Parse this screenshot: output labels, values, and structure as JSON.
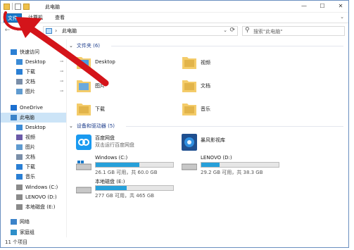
{
  "window": {
    "title": "此电脑",
    "minimize": "—",
    "maximize": "☐",
    "close": "✕"
  },
  "ribbon": {
    "tabs": [
      "文件",
      "计算机",
      "查看"
    ],
    "expand": "⌄"
  },
  "address": {
    "back": "←",
    "forward": "→",
    "up": "↑",
    "separator": "›",
    "path": "此电脑",
    "refresh": "⟳",
    "search_placeholder": "搜索\"此电脑\""
  },
  "sidebar": {
    "items": [
      {
        "label": "快速访问",
        "icon": "star-icon",
        "pinned": false
      },
      {
        "label": "Desktop",
        "icon": "desktop-folder-icon",
        "pinned": true
      },
      {
        "label": "下载",
        "icon": "download-folder-icon",
        "pinned": true
      },
      {
        "label": "文档",
        "icon": "documents-folder-icon",
        "pinned": true
      },
      {
        "label": "图片",
        "icon": "pictures-folder-icon",
        "pinned": true
      },
      {
        "label": "OneDrive",
        "icon": "cloud-icon",
        "pinned": false
      },
      {
        "label": "此电脑",
        "icon": "pc-icon",
        "pinned": false
      },
      {
        "label": "Desktop",
        "icon": "desktop-folder-icon",
        "pinned": false
      },
      {
        "label": "视频",
        "icon": "videos-folder-icon",
        "pinned": false
      },
      {
        "label": "图片",
        "icon": "pictures-folder-icon",
        "pinned": false
      },
      {
        "label": "文档",
        "icon": "documents-folder-icon",
        "pinned": false
      },
      {
        "label": "下载",
        "icon": "download-folder-icon",
        "pinned": false
      },
      {
        "label": "音乐",
        "icon": "music-folder-icon",
        "pinned": false
      },
      {
        "label": "Windows (C:)",
        "icon": "windows-drive-icon",
        "pinned": false
      },
      {
        "label": "LENOVO (D:)",
        "icon": "drive-icon",
        "pinned": false
      },
      {
        "label": "本地磁盘 (E:)",
        "icon": "drive-icon",
        "pinned": false
      },
      {
        "label": "网络",
        "icon": "network-icon",
        "pinned": false
      },
      {
        "label": "家庭组",
        "icon": "homegroup-icon",
        "pinned": false
      }
    ]
  },
  "folders_group": {
    "label": "文件夹 (6)",
    "chevron": "⌄"
  },
  "folders": [
    {
      "label": "Desktop",
      "icon": "desktop-folder-icon"
    },
    {
      "label": "视频",
      "icon": "videos-folder-icon"
    },
    {
      "label": "图片",
      "icon": "pictures-folder-icon"
    },
    {
      "label": "文档",
      "icon": "documents-folder-icon"
    },
    {
      "label": "下载",
      "icon": "download-folder-icon"
    },
    {
      "label": "音乐",
      "icon": "music-folder-icon"
    }
  ],
  "devices_group": {
    "label": "设备和驱动器 (5)",
    "chevron": "⌄"
  },
  "devices": [
    {
      "name": "百度网盘",
      "sub": "双击运行百度网盘",
      "icon": "baidu-netdisk-icon"
    },
    {
      "name": "暴风影视库",
      "sub": "",
      "icon": "baofeng-icon"
    }
  ],
  "drives": [
    {
      "name": "Windows (C:)",
      "size": "26.1 GB 可用，共 60.0 GB",
      "used_fraction": 0.565,
      "icon": "windows-drive-icon"
    },
    {
      "name": "LENOVO (D:)",
      "size": "29.2 GB 可用，共 38.3 GB",
      "used_fraction": 0.238,
      "icon": "drive-icon"
    },
    {
      "name": "本地磁盘 (E:)",
      "size": "277 GB 可用，共 465 GB",
      "used_fraction": 0.404,
      "icon": "drive-icon"
    }
  ],
  "status": {
    "text": "11 个项目"
  },
  "colors": {
    "accent": "#1979ca",
    "selection": "#cce4f7",
    "bar_fill": "#26a0da",
    "arrow": "#d4141a",
    "group_text": "#1e3e8c"
  }
}
